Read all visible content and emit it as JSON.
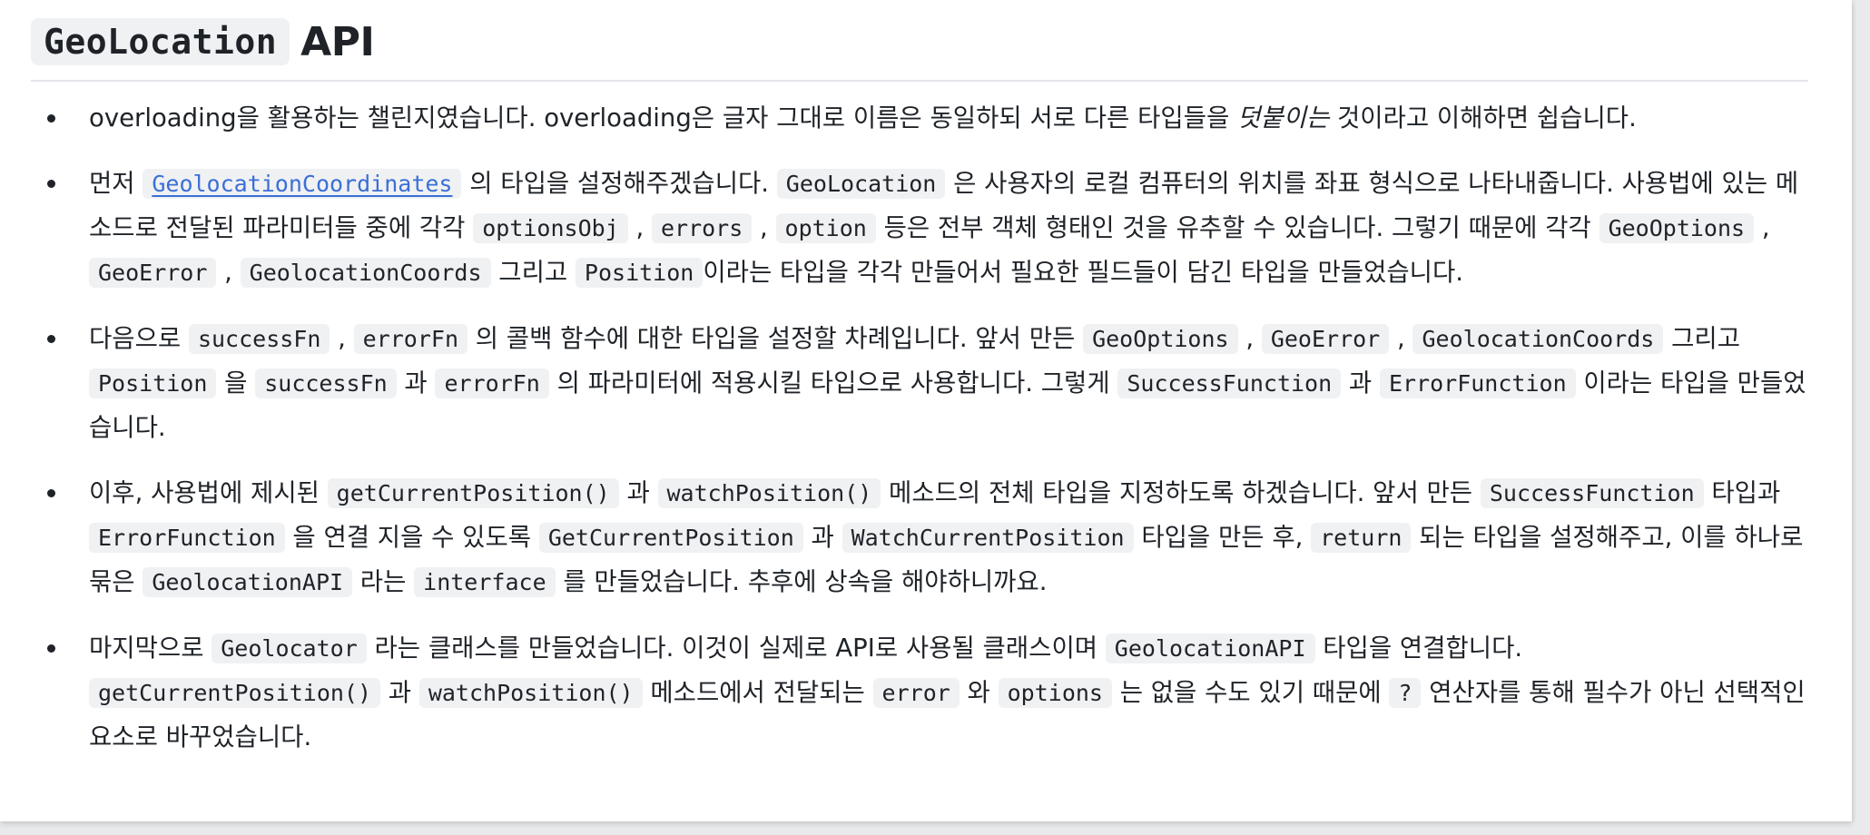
{
  "heading": {
    "code": "GeoLocation",
    "text": "API"
  },
  "items": [
    {
      "t1": "overloading을 활용하는 챌린지였습니다. overloading은 글자 그대로 이름은 동일하되 서로 다른 타입들을 ",
      "em": "덧붙이는",
      "t2": " 것이라고 이해하면 쉽습니다."
    },
    {
      "t1": "먼저 ",
      "link": "GeolocationCoordinates",
      "t2": " 의 타입을 설정해주겠습니다. ",
      "c1": "GeoLocation",
      "t3": " 은 사용자의 로컬 컴퓨터의 위치를 좌표 형식으로 나타내줍니다. 사용법에 있는 메소드로 전달된 파라미터들 중에 각각 ",
      "c2": "optionsObj",
      "t4": " , ",
      "c3": "errors",
      "t5": " , ",
      "c4": "option",
      "t6": " 등은 전부 객체 형태인 것을 유추할 수 있습니다. 그렇기 때문에 각각 ",
      "c5": "GeoOptions",
      "t7": " , ",
      "c6": "GeoError",
      "t8": " , ",
      "c7": "GeolocationCoords",
      "t9": " 그리고 ",
      "c8": "Position",
      "t10": "이라는 타입을 각각 만들어서 필요한 필드들이 담긴 타입을 만들었습니다."
    },
    {
      "t1": "다음으로 ",
      "c1": "successFn",
      "t2": " , ",
      "c2": "errorFn",
      "t3": " 의 콜백 함수에 대한 타입을 설정할 차례입니다. 앞서 만든 ",
      "c3": "GeoOptions",
      "t4": " , ",
      "c4": "GeoError",
      "t5": " , ",
      "c5": "GeolocationCoords",
      "t6": " 그리고 ",
      "c6": "Position",
      "t7": " 을 ",
      "c7": "successFn",
      "t8": " 과 ",
      "c8": "errorFn",
      "t9": " 의 파라미터에 적용시킬 타입으로 사용합니다. 그렇게 ",
      "c9": "SuccessFunction",
      "t10": " 과 ",
      "c10": "ErrorFunction",
      "t11": " 이라는 타입을 만들었습니다."
    },
    {
      "t1": "이후, 사용법에 제시된 ",
      "c1": "getCurrentPosition()",
      "t2": " 과 ",
      "c2": "watchPosition()",
      "t3": " 메소드의 전체 타입을 지정하도록 하겠습니다. 앞서 만든 ",
      "c3": "SuccessFunction",
      "t4": " 타입과 ",
      "c4": "ErrorFunction",
      "t5": " 을 연결 지을 수 있도록 ",
      "c5": "GetCurrentPosition",
      "t6": " 과 ",
      "c6": "WatchCurrentPosition",
      "t7": " 타입을 만든 후, ",
      "c7": "return",
      "t8": " 되는 타입을 설정해주고, 이를 하나로 묶은 ",
      "c8": "GeolocationAPI",
      "t9": " 라는 ",
      "c9": "interface",
      "t10": " 를 만들었습니다. 추후에 상속을 해야하니까요."
    },
    {
      "t1": "마지막으로 ",
      "c1": "Geolocator",
      "t2": " 라는 클래스를 만들었습니다. 이것이 실제로 API로 사용될 클래스이며 ",
      "c2": "GeolocationAPI",
      "t3": " 타입을 연결합니다. ",
      "c3": "getCurrentPosition()",
      "t4": " 과 ",
      "c4": "watchPosition()",
      "t5": " 메소드에서 전달되는 ",
      "c5": "error",
      "t6": " 와 ",
      "c6": "options",
      "t7": " 는 없을 수도 있기 때문에 ",
      "c7": "?",
      "t8": " 연산자를 통해 필수가 아닌 선택적인 요소로 바꾸었습니다."
    }
  ]
}
